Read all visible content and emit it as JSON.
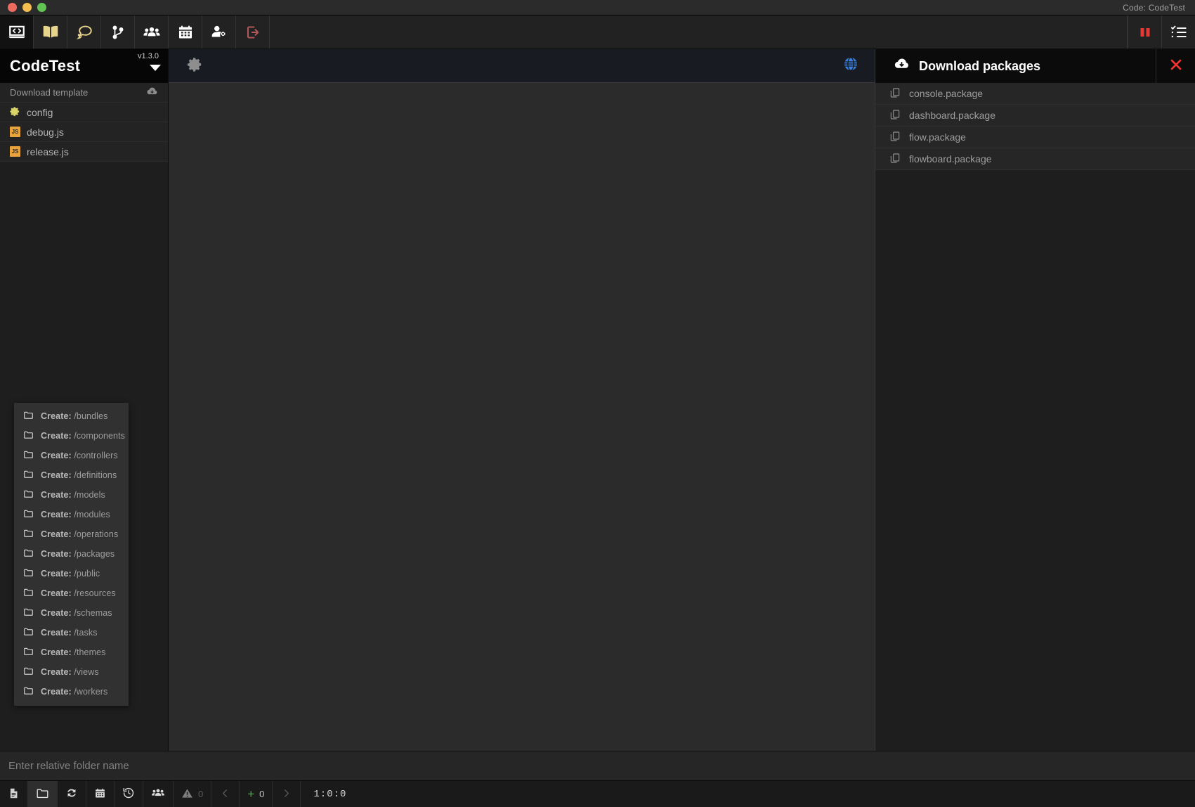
{
  "window": {
    "title": "Code: CodeTest",
    "traffic_lights": [
      "close",
      "minimize",
      "maximize"
    ]
  },
  "toolbar": {
    "left_items": [
      {
        "name": "laptop-code-icon",
        "label": "Code"
      },
      {
        "name": "book-icon",
        "label": "Docs"
      },
      {
        "name": "comments-icon",
        "label": "Chat"
      },
      {
        "name": "code-branch-icon",
        "label": "Branches"
      },
      {
        "name": "users-icon",
        "label": "Team"
      },
      {
        "name": "calendar-icon",
        "label": "Calendar"
      },
      {
        "name": "user-gear-icon",
        "label": "Account"
      },
      {
        "name": "sign-out-icon",
        "label": "Sign out"
      }
    ],
    "right_items": [
      {
        "name": "pause-icon",
        "label": "Pause"
      },
      {
        "name": "task-list-icon",
        "label": "Tasks"
      }
    ]
  },
  "sidebar": {
    "title": "CodeTest",
    "version": "v1.3.0",
    "caret": "chevron-down-icon",
    "download_template": "Download template",
    "files": [
      {
        "label": "config",
        "icon": "gear-icon"
      },
      {
        "label": "debug.js",
        "icon": "js-file-icon"
      },
      {
        "label": "release.js",
        "icon": "js-file-icon"
      }
    ]
  },
  "editor": {
    "settings_icon": "gear-icon",
    "globe_icon": "globe-icon",
    "content": ""
  },
  "right_panel": {
    "title": "Download packages",
    "icon": "cloud-download-icon",
    "close_icon": "close-icon",
    "packages": [
      "console.package",
      "dashboard.package",
      "flow.package",
      "flowboard.package"
    ]
  },
  "context_menu": {
    "prefix": "Create:",
    "items": [
      "/bundles",
      "/components",
      "/controllers",
      "/definitions",
      "/models",
      "/modules",
      "/operations",
      "/packages",
      "/public",
      "/resources",
      "/schemas",
      "/tasks",
      "/themes",
      "/views",
      "/workers"
    ]
  },
  "input_bar": {
    "placeholder": "Enter relative folder name",
    "value": ""
  },
  "status_bar": {
    "buttons": [
      {
        "name": "new-file-button",
        "icon": "file-icon",
        "label": ""
      },
      {
        "name": "new-folder-button",
        "icon": "folder-icon",
        "label": "",
        "active": true
      },
      {
        "name": "refresh-button",
        "icon": "sync-icon",
        "label": ""
      },
      {
        "name": "calendar-button",
        "icon": "calendar-icon",
        "label": ""
      },
      {
        "name": "history-button",
        "icon": "history-icon",
        "label": ""
      },
      {
        "name": "users-button",
        "icon": "users-icon",
        "label": ""
      },
      {
        "name": "warnings-button",
        "icon": "warning-icon",
        "label": "0"
      },
      {
        "name": "prev-button",
        "icon": "chevron-left-icon",
        "label": ""
      },
      {
        "name": "additions-button",
        "icon": "plus-icon",
        "label": "0"
      },
      {
        "name": "next-button",
        "icon": "chevron-right-icon",
        "label": ""
      }
    ],
    "position": "1:0:0"
  },
  "colors": {
    "accent_gold": "#e8d48b",
    "accent_red": "#e53935",
    "accent_blue": "#3b82e0",
    "accent_green": "#4caf50",
    "panel_bg": "#1e1e1e",
    "editor_bg": "#2b2b2b"
  }
}
